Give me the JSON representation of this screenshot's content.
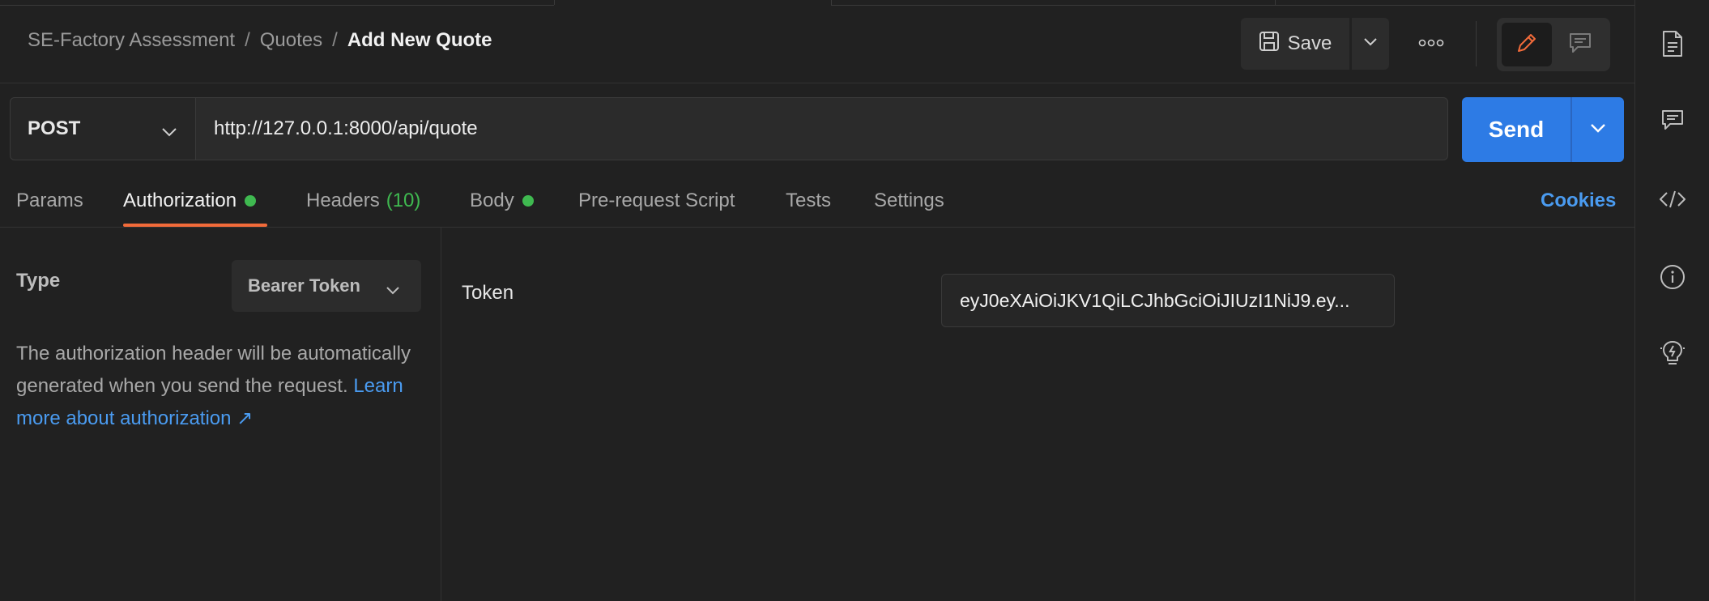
{
  "header": {
    "breadcrumb": [
      "SE-Factory Assessment",
      "Quotes"
    ],
    "breadcrumb_separator": "/",
    "title": "Add New Quote",
    "save_label": "Save"
  },
  "request": {
    "method": "POST",
    "url": "http://127.0.0.1:8000/api/quote",
    "send_label": "Send"
  },
  "tabs": {
    "params": "Params",
    "authorization": "Authorization",
    "headers": "Headers",
    "headers_count": "(10)",
    "body": "Body",
    "prerequest": "Pre-request Script",
    "tests": "Tests",
    "settings": "Settings",
    "cookies": "Cookies",
    "active": "Authorization"
  },
  "auth": {
    "type_label": "Type",
    "type_value": "Bearer Token",
    "description": "The authorization header will be automatically generated when you send the request.",
    "learn_more": "Learn more about authorization ↗",
    "token_label": "Token",
    "token_value": "eyJ0eXAiOiJKV1QiLCJhbGciOiJIUzI1NiJ9.ey..."
  },
  "colors": {
    "accent_blue": "#2d7be5",
    "link_blue": "#4a9bf0",
    "active_underline": "#f26b3a",
    "status_green": "#3fb950",
    "background": "#212121"
  },
  "sidebar": {
    "icons": [
      "document-icon",
      "comment-icon",
      "code-icon",
      "info-icon",
      "lightbulb-icon"
    ]
  }
}
